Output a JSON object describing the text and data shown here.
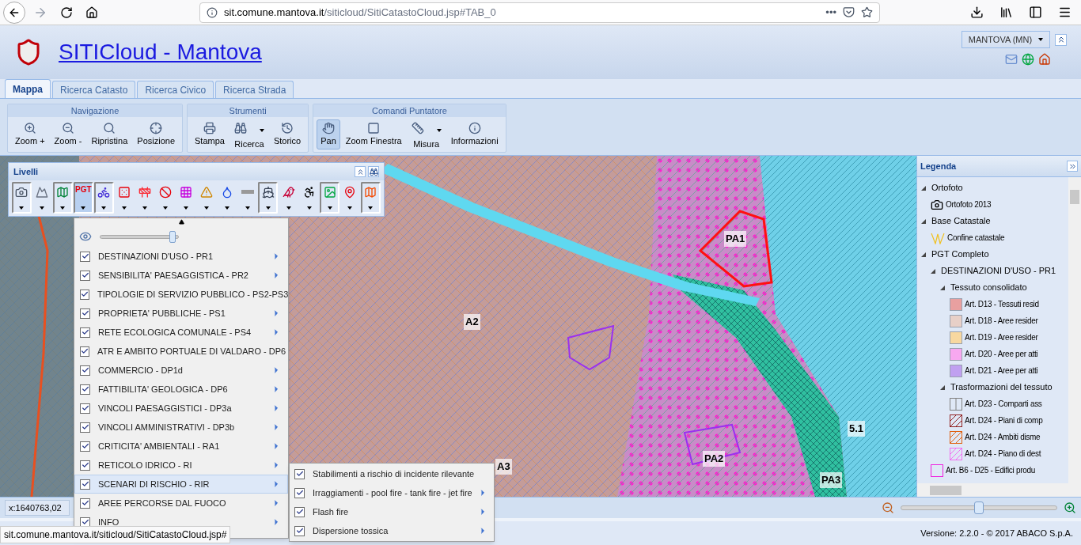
{
  "browser": {
    "url_host": "sit.comune.mantova.it",
    "url_path": "/siticloud/SitiCatastoCloud.jsp#TAB_0",
    "more": "•••"
  },
  "header": {
    "title": "SITICloud - Mantova",
    "municipality": "MANTOVA (MN)"
  },
  "tabs": [
    {
      "label": "Mappa",
      "selected": true
    },
    {
      "label": "Ricerca Catasto",
      "selected": false
    },
    {
      "label": "Ricerca Civico",
      "selected": false
    },
    {
      "label": "Ricerca Strada",
      "selected": false
    }
  ],
  "toolbar": [
    {
      "title": "Navigazione",
      "tools": [
        {
          "label": "Zoom +",
          "selected": false,
          "menu": false
        },
        {
          "label": "Zoom -",
          "selected": false,
          "menu": false
        },
        {
          "label": "Ripristina",
          "selected": false,
          "menu": false
        },
        {
          "label": "Posizione",
          "selected": false,
          "menu": false
        }
      ]
    },
    {
      "title": "Strumenti",
      "tools": [
        {
          "label": "Stampa",
          "selected": false,
          "menu": false
        },
        {
          "label": "Ricerca",
          "selected": false,
          "menu": true
        },
        {
          "label": "Storico",
          "selected": false,
          "menu": false
        }
      ]
    },
    {
      "title": "Comandi Puntatore",
      "tools": [
        {
          "label": "Pan",
          "selected": true,
          "menu": false
        },
        {
          "label": "Zoom Finestra",
          "selected": false,
          "menu": false
        },
        {
          "label": "Misura",
          "selected": false,
          "menu": true
        },
        {
          "label": "Informazioni",
          "selected": false,
          "menu": false
        }
      ]
    }
  ],
  "map_labels": [
    {
      "text": "A2",
      "kind": "plain"
    },
    {
      "text": "PA1",
      "kind": "plain"
    },
    {
      "text": "PA2",
      "kind": "plain"
    },
    {
      "text": "PA3",
      "kind": "plain"
    },
    {
      "text": "5.1",
      "kind": "plain"
    },
    {
      "text": "A3",
      "kind": "plain"
    }
  ],
  "layers_panel": {
    "title": "Livelli",
    "buttons": [
      {
        "active": true,
        "selected": false
      },
      {
        "active": false,
        "selected": false
      },
      {
        "active": true,
        "selected": false
      },
      {
        "active": true,
        "selected": true,
        "label": "PGT"
      },
      {
        "active": true,
        "selected": false
      },
      {
        "active": false,
        "selected": false
      },
      {
        "active": false,
        "selected": false
      },
      {
        "active": false,
        "selected": false
      },
      {
        "active": false,
        "selected": false
      },
      {
        "active": false,
        "selected": false
      },
      {
        "active": false,
        "selected": false
      },
      {
        "active": false,
        "selected": false
      },
      {
        "active": true,
        "selected": false
      },
      {
        "active": false,
        "selected": false
      },
      {
        "active": false,
        "selected": false
      },
      {
        "active": true,
        "selected": false
      },
      {
        "active": false,
        "selected": false
      },
      {
        "active": true,
        "selected": false
      }
    ]
  },
  "layer_menu": {
    "opacity": {
      "level": 0.93
    },
    "items": [
      {
        "label": "DESTINAZIONI D'USO - PR1",
        "checked": true,
        "selected": false
      },
      {
        "label": "SENSIBILITA' PAESAGGISTICA - PR2",
        "checked": true,
        "selected": false
      },
      {
        "label": "TIPOLOGIE DI SERVIZIO PUBBLICO - PS2-PS3",
        "checked": true,
        "selected": false
      },
      {
        "label": "PROPRIETA' PUBBLICHE - PS1",
        "checked": true,
        "selected": false
      },
      {
        "label": "RETE ECOLOGICA COMUNALE - PS4",
        "checked": true,
        "selected": false
      },
      {
        "label": "ATR E AMBITO PORTUALE DI VALDARO - DP6",
        "checked": true,
        "selected": false
      },
      {
        "label": "COMMERCIO - DP1d",
        "checked": true,
        "selected": false
      },
      {
        "label": "FATTIBILITA' GEOLOGICA - DP6",
        "checked": true,
        "selected": false
      },
      {
        "label": "VINCOLI PAESAGGISTICI - DP3a",
        "checked": true,
        "selected": false
      },
      {
        "label": "VINCOLI AMMINISTRATIVI - DP3b",
        "checked": true,
        "selected": false
      },
      {
        "label": "CRITICITA' AMBIENTALI - RA1",
        "checked": true,
        "selected": false
      },
      {
        "label": "RETICOLO IDRICO - RI",
        "checked": true,
        "selected": false
      },
      {
        "label": "SCENARI DI RISCHIO - RIR",
        "checked": true,
        "selected": true
      },
      {
        "label": "AREE PERCORSE DAL FUOCO",
        "checked": true,
        "selected": false
      },
      {
        "label": "INFO",
        "checked": true,
        "selected": false
      }
    ]
  },
  "submenu": [
    {
      "label": "Stabilimenti a rischio di incidente rilevante",
      "checked": true,
      "submenu": false
    },
    {
      "label": "Irraggiamenti - pool fire - tank fire - jet fire",
      "checked": true,
      "submenu": true
    },
    {
      "label": "Flash fire",
      "checked": true,
      "submenu": true
    },
    {
      "label": "Dispersione tossica",
      "checked": true,
      "submenu": true
    }
  ],
  "legend": {
    "title": "Legenda",
    "items": [
      {
        "label": "Ortofoto",
        "kind": "group",
        "expanded": true,
        "children": [
          {
            "label": "Ortofoto 2013",
            "kind": "camera"
          }
        ]
      },
      {
        "label": "Base Catastale",
        "kind": "group",
        "expanded": true,
        "children": [
          {
            "label": "Confine catastale",
            "kind": "line",
            "color": "#f0c020"
          }
        ]
      },
      {
        "label": "PGT Completo",
        "kind": "group",
        "expanded": true,
        "children": [
          {
            "label": "DESTINAZIONI D'USO - PR1",
            "kind": "group",
            "expanded": true,
            "children": [
              {
                "label": "Tessuto consolidato",
                "kind": "group",
                "expanded": true,
                "children": [
                  {
                    "label": "Art. D13 - Tessuti resid",
                    "kind": "fill",
                    "color": "#e8a0a0"
                  },
                  {
                    "label": "Art. D18 - Aree resider",
                    "kind": "fill",
                    "color": "#e8d0c8"
                  },
                  {
                    "label": "Art. D19 - Aree resider",
                    "kind": "fill",
                    "color": "#f8d8a0"
                  },
                  {
                    "label": "Art. D20 - Aree per atti",
                    "kind": "fill",
                    "color": "#f8a8f0"
                  },
                  {
                    "label": "Art. D21 - Aree per atti",
                    "kind": "fill",
                    "color": "#c0a0f0"
                  }
                ]
              },
              {
                "label": "Trasformazioni del tessuto",
                "kind": "group",
                "expanded": true,
                "children": [
                  {
                    "label": "Art. D23 - Comparti ass",
                    "kind": "split",
                    "color": "#808080"
                  },
                  {
                    "label": "Art. D24 - Piani di comp",
                    "kind": "hatch",
                    "color": "#902020"
                  },
                  {
                    "label": "Art. D24 - Ambiti disme",
                    "kind": "hatch",
                    "color": "#e06010"
                  },
                  {
                    "label": "Art. D24 - Piano di dest",
                    "kind": "hatch",
                    "color": "#f070f0"
                  }
                ]
              }
            ]
          },
          {
            "label": "Art. B6 - D25 - Edifici produ",
            "kind": "outline",
            "color": "#f020e0"
          }
        ]
      }
    ]
  },
  "coordinates": "x:1640763,02",
  "map_zoom": {
    "level": 0.5
  },
  "status_url": "sit.comune.mantova.it/siticloud/SitiCatastoCloud.jsp#",
  "footer": "Versione: 2.2.0 - © 2017 ABACO S.p.A."
}
